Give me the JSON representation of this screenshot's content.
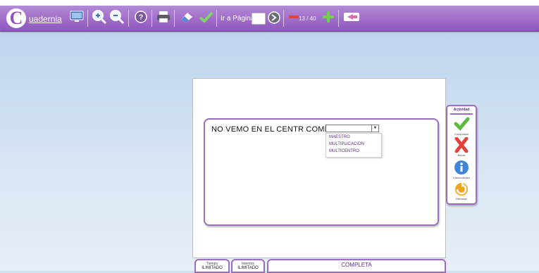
{
  "app": {
    "logo_letter": "C",
    "logo_text": "uadernia"
  },
  "toolbar": {
    "goto_label": "Ir a Página",
    "goto_value": "",
    "page_indicator": "13 / 40",
    "icons": [
      "monitor-icon",
      "zoom-in-icon",
      "zoom-out-icon",
      "help-icon",
      "print-icon",
      "clear-icon",
      "check-icon",
      "next-arrow-icon",
      "prev-page-icon",
      "next-page-icon",
      "exit-icon"
    ]
  },
  "exercise": {
    "sentence": "NO  VEMO EN EL CENTR COMERCI",
    "select_value": "",
    "options": [
      "MAESTRO",
      "MULTIPLICACION",
      "MULTICENTRO"
    ]
  },
  "side_panel": {
    "title": "Actividad",
    "buttons": [
      "Comprobar",
      "Borrar",
      "Instrucciones",
      "Reiniciar"
    ]
  },
  "status": {
    "time_label": "Tiempo",
    "time_value": "ILIMITADO",
    "attempts_label": "Intentos",
    "attempts_value": "ILIMITADO",
    "state": "COMPLETA"
  },
  "colors": {
    "toolbar": "#9c67c8",
    "accent": "#8f55bf",
    "background": "#d3e2f3"
  }
}
